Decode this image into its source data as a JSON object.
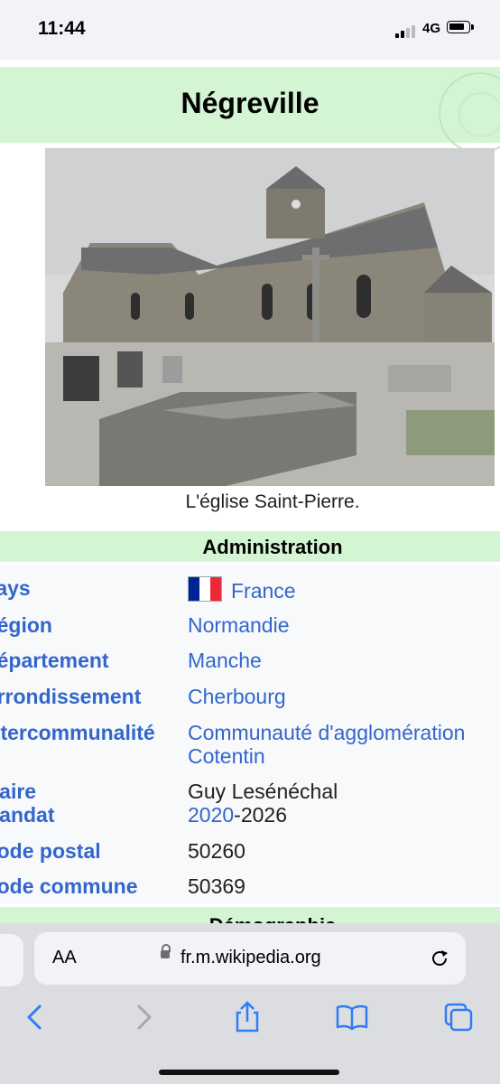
{
  "status_bar": {
    "time": "11:44",
    "network": "4G"
  },
  "page": {
    "title": "Négreville",
    "caption": "L'église Saint-Pierre.",
    "section_title": "Administration",
    "rows": [
      {
        "label": "Pays",
        "value": "France"
      },
      {
        "label": "Région",
        "value": "Normandie"
      },
      {
        "label": "Département",
        "value": "Manche"
      },
      {
        "label": "Arrondissement",
        "value": "Cherbourg"
      },
      {
        "label": "Intercommunalité",
        "value_line1": "Communauté d'agglomération",
        "value_line2": "Cotentin"
      },
      {
        "label_line1": "Maire",
        "label_line2": "Mandat",
        "value_line1": "Guy Lesénéchal",
        "value_line2_link": "2020",
        "value_line2_rest": "-2026"
      },
      {
        "label": "Code postal",
        "value": "50260"
      },
      {
        "label": "Code commune",
        "value": "50369"
      }
    ],
    "next_section_title": "Démographie"
  },
  "browser": {
    "aa_label": "AA",
    "url": "fr.m.wikipedia.org"
  },
  "colors": {
    "link": "#3366cc",
    "band": "#d4f5d4"
  }
}
